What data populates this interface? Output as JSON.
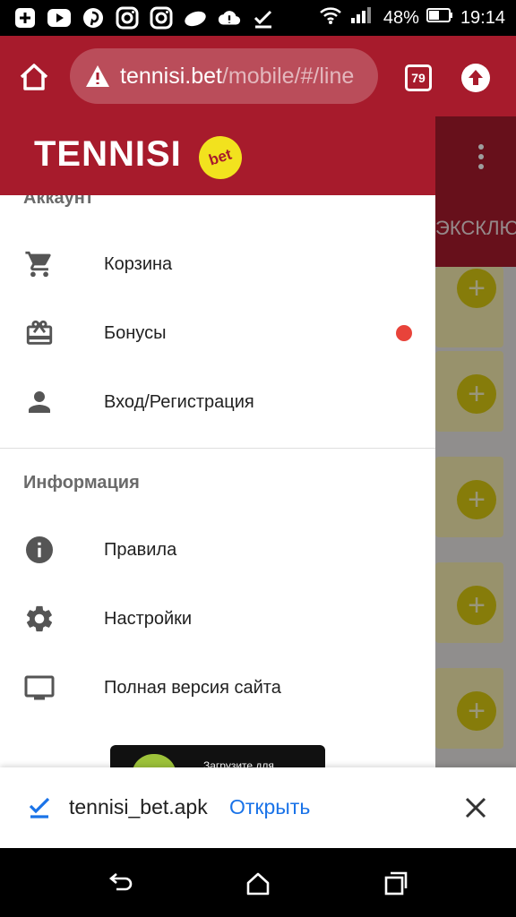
{
  "status_bar": {
    "battery": "48%",
    "time": "19:14",
    "icons": [
      "add-box-icon",
      "youtube-icon",
      "pinterest-icon",
      "instagram-icon",
      "instagram-icon",
      "cloud-icon",
      "cloud-warning-icon",
      "check-icon",
      "wifi-icon",
      "signal-icon",
      "battery-icon"
    ]
  },
  "browser": {
    "url_host": "tennisi.bet",
    "url_path": "/mobile/#/line",
    "tab_count": "79"
  },
  "page": {
    "tab_label": "ЭКСКЛЮЗИВ"
  },
  "drawer": {
    "logo_text": "TENNISI",
    "logo_badge": "bet",
    "section_account": "Аккаунт",
    "account_items": [
      {
        "label": "Корзина",
        "icon": "cart-icon"
      },
      {
        "label": "Бонусы",
        "icon": "gift-icon"
      },
      {
        "label": "Вход/Регистрация",
        "icon": "person-icon"
      }
    ],
    "section_info": "Информация",
    "info_items": [
      {
        "label": "Правила",
        "icon": "info-icon"
      },
      {
        "label": "Настройки",
        "icon": "gear-icon"
      },
      {
        "label": "Полная версия сайта",
        "icon": "monitor-icon"
      }
    ],
    "android_banner_text": "Загрузите для"
  },
  "download": {
    "filename": "tennisi_bet.apk",
    "action": "Открыть"
  },
  "colors": {
    "brand_red": "#a71b2c",
    "accent_yellow": "#f2e21e",
    "badge_red": "#e8433a",
    "link_blue": "#1a73e8"
  }
}
